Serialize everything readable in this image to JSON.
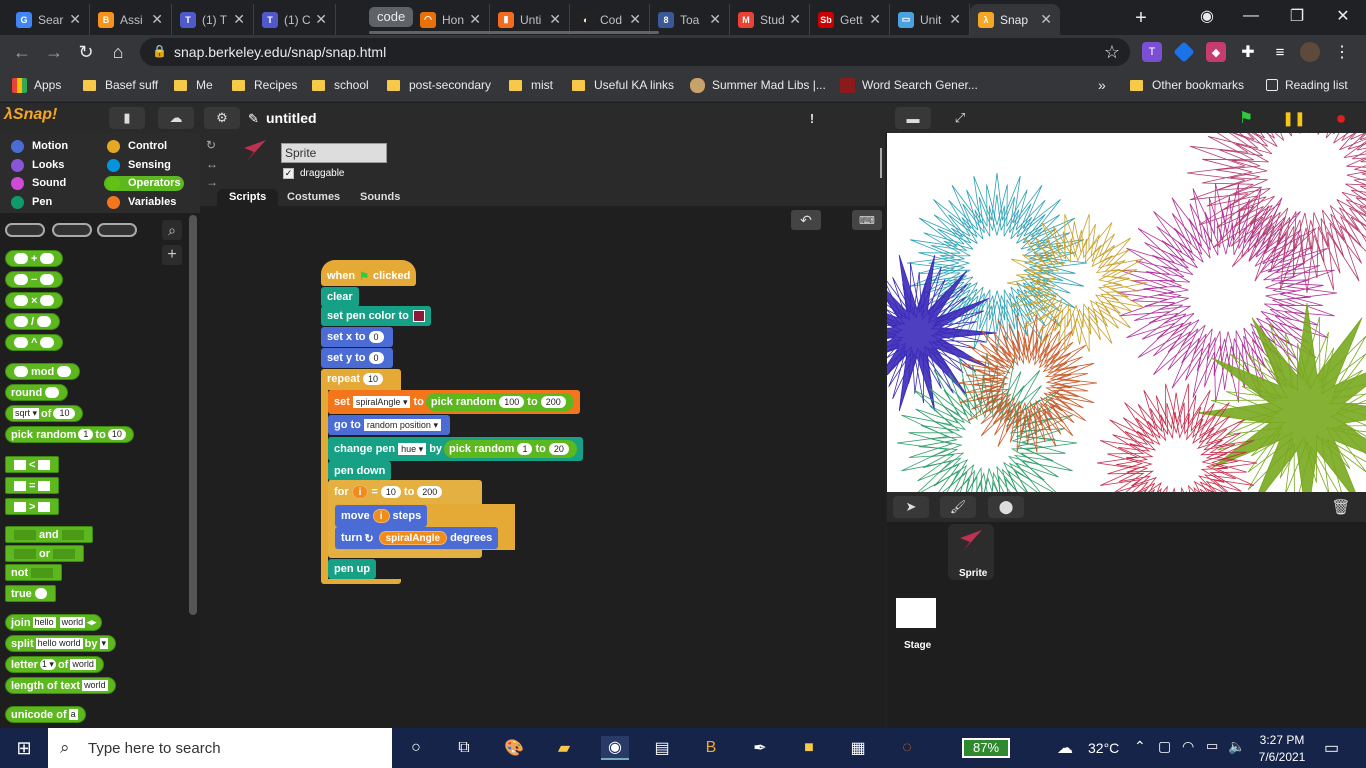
{
  "browser": {
    "tabs": [
      {
        "label": "Sear",
        "fav_color": "#4285f4",
        "fav": "G"
      },
      {
        "label": "Assi",
        "fav_color": "#f7931a",
        "fav": "B"
      },
      {
        "label": "(1) T",
        "fav_color": "#5059c9",
        "fav": "T"
      },
      {
        "label": "(1) C",
        "fav_color": "#5059c9",
        "fav": "T"
      },
      {
        "label": "Hon",
        "fav_color": "#e8710a",
        "fav": "◠"
      },
      {
        "label": "Unti",
        "fav_color": "#f26b21",
        "fav": "▮"
      },
      {
        "label": "Cod",
        "fav_color": "#222222",
        "fav": "◐"
      },
      {
        "label": "Toa",
        "fav_color": "#3b5998",
        "fav": "8"
      },
      {
        "label": "Stud",
        "fav_color": "#ea4335",
        "fav": "M"
      },
      {
        "label": "Gett",
        "fav_color": "#cc0000",
        "fav": "Sb"
      },
      {
        "label": "Unit",
        "fav_color": "#4aa3df",
        "fav": "▭"
      },
      {
        "label": "Snap",
        "fav_color": "#f5a623",
        "fav": "λ"
      }
    ],
    "group_label": "code",
    "url": "snap.berkeley.edu/snap/snap.html",
    "bookmarks": [
      "Apps",
      "Basef suff",
      "Me",
      "Recipes",
      "school",
      "post-secondary",
      "mist",
      "Useful KA links",
      "Summer Mad Libs |...",
      "Word Search Gener...",
      "Other bookmarks",
      "Reading list"
    ]
  },
  "snap": {
    "logo": "λSnap!",
    "project_title": "untitled",
    "categories": [
      "Motion",
      "Looks",
      "Sound",
      "Pen",
      "Control",
      "Sensing",
      "Operators",
      "Variables"
    ],
    "category_colors": [
      "#4a6cd4",
      "#8a55d7",
      "#cf4ad9",
      "#0e9a6c",
      "#e6a822",
      "#0494dc",
      "#62c213",
      "#f3761d"
    ],
    "palette": {
      "plus": "+",
      "minus": "−",
      "times": "×",
      "divide": "/",
      "power": "^",
      "mod": "mod",
      "round": "round",
      "sqrt": "sqrt",
      "of": "of",
      "sqrt_val": "10",
      "pick_random": "pick random",
      "pr_a": "1",
      "to": "to",
      "pr_b": "10",
      "lt": "<",
      "eq": "=",
      "gt": ">",
      "and": "and",
      "or": "or",
      "not": "not",
      "true": "true",
      "join": "join",
      "hello": "hello",
      "world": "world",
      "split": "split",
      "split_val": "hello world",
      "by": "by",
      "letter": "letter",
      "letter_val": "1",
      "length_of_text": "length of text",
      "unicode_of": "unicode of",
      "unicode_val": "a"
    },
    "sprite_name": "Sprite",
    "draggable": "draggable",
    "sprite_tabs": [
      "Scripts",
      "Costumes",
      "Sounds"
    ],
    "script": {
      "when": "when",
      "clicked": "clicked",
      "clear": "clear",
      "set_pen_color": "set pen color to",
      "set_x": "set x to",
      "x_val": "0",
      "set_y": "set y to",
      "y_val": "0",
      "repeat": "repeat",
      "repeat_val": "10",
      "set": "set",
      "var": "spiralAngle",
      "to": "to",
      "pick_random": "pick random",
      "pr_a": "100",
      "pr_b": "200",
      "go_to": "go to",
      "go_to_val": "random position",
      "change_pen": "change pen",
      "hue": "hue",
      "by": "by",
      "cp_a": "1",
      "cp_b": "20",
      "pen_down": "pen down",
      "for": "for",
      "i": "i",
      "eq": "=",
      "for_a": "10",
      "for_b": "200",
      "move": "move",
      "steps": "steps",
      "turn": "turn",
      "degrees": "degrees",
      "pen_up": "pen up"
    },
    "corral": {
      "sprite": "Sprite",
      "stage": "Stage"
    }
  },
  "taskbar": {
    "search_placeholder": "Type here to search",
    "battery": "87%",
    "weather": "32°C",
    "time": "3:27 PM",
    "date": "7/6/2021"
  }
}
